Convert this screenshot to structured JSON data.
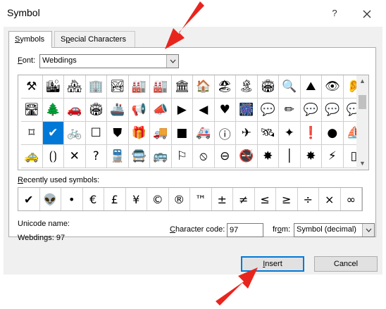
{
  "window": {
    "title": "Symbol",
    "help_label": "?"
  },
  "tabs": [
    {
      "label": "Symbols",
      "accel": "S",
      "rest": "ymbols",
      "active": true
    },
    {
      "label": "Special Characters",
      "pre": "S",
      "accel": "p",
      "rest": "ecial Characters",
      "active": false
    }
  ],
  "font": {
    "label": "Font:",
    "accel": "F",
    "rest": "ont:",
    "value": "Webdings"
  },
  "symbol_grid": {
    "selected_index": 33,
    "icons": [
      "tools-icon",
      "city-icon",
      "houses-icon",
      "city-skyline-icon",
      "house-scene-icon",
      "farm-icon",
      "factory-icon",
      "public-building-icon",
      "house-icon",
      "beach-icon",
      "island-icon",
      "stadium-icon",
      "magnifier-icon",
      "mountain-icon",
      "eye-icon",
      "ear-icon",
      "road-icon",
      "forest-icon",
      "car-icon",
      "stadium2-icon",
      "ship-icon",
      "megaphone-icon",
      "megaphone2-icon",
      "play-icon",
      "rewind-icon",
      "heart-icon",
      "fireworks-icon",
      "speech-bubble-icon",
      "pencil-icon",
      "chat-icon",
      "chat2-icon",
      "chat3-icon",
      "frame-icon",
      "checkbox-icon",
      "bicycle-icon",
      "empty-box-icon",
      "shield-icon",
      "gift-icon",
      "truck-icon",
      "black-square-icon",
      "ambulance-icon",
      "info-icon",
      "airplane-icon",
      "satellite-icon",
      "compass-icon",
      "exclamation-icon",
      "black-circle-icon",
      "boat-icon",
      "taxi-icon",
      "brackets-icon",
      "cross-icon",
      "question-icon",
      "train-icon",
      "bus-icon",
      "bus2-icon",
      "flag-icon",
      "no-entry-icon",
      "no-sign-icon",
      "no-smoking-icon",
      "splash-icon",
      "bar-icon",
      "splash2-icon",
      "lightning-icon",
      "rectangle-icon"
    ],
    "glyphs": [
      "⚒",
      "🏙",
      "🏘",
      "🏢",
      "🏞",
      "🏭",
      "🏭",
      "🏛",
      "🏠",
      "🏖",
      "🏝",
      "🏟",
      "🔍",
      "⛰",
      "👁",
      "👂",
      "🛣",
      "🌲",
      "🚗",
      "🏟",
      "🚢",
      "📢",
      "📣",
      "▶",
      "◀",
      "♥",
      "🎆",
      "💬",
      "✏",
      "💬",
      "💬",
      "💬",
      "⌑",
      "✔",
      "🚲",
      "☐",
      "⛊",
      "🎁",
      "🚚",
      "■",
      "🚑",
      "ⓘ",
      "✈",
      "🛰",
      "✦",
      "❗",
      "●",
      "⛵",
      "🚕",
      "⟮⟯",
      "✕",
      "?",
      "🚆",
      "🚍",
      "🚌",
      "⚐",
      "⦸",
      "⊖",
      "🚭",
      "✸",
      "│",
      "✸",
      "⚡",
      "▯"
    ]
  },
  "recent": {
    "label": "Recently used symbols:",
    "accel": "R",
    "rest": "ecently used symbols:",
    "symbols": [
      "✔",
      "👽",
      "•",
      "€",
      "£",
      "¥",
      "©",
      "®",
      "™",
      "±",
      "≠",
      "≤",
      "≥",
      "÷",
      "×",
      "∞"
    ]
  },
  "unicode": {
    "label": "Unicode name:",
    "value": "Webdings: 97"
  },
  "char_code": {
    "label": "Character code:",
    "accel": "C",
    "rest": "haracter code:",
    "value": "97"
  },
  "from": {
    "label": "from:",
    "pre": "fr",
    "accel": "o",
    "rest": "m:",
    "value": "Symbol (decimal)"
  },
  "buttons": {
    "insert": {
      "label": "Insert",
      "accel": "I",
      "rest": "nsert"
    },
    "cancel": {
      "label": "Cancel"
    }
  },
  "colors": {
    "accent": "#0078d7",
    "arrow": "#e8251d"
  }
}
